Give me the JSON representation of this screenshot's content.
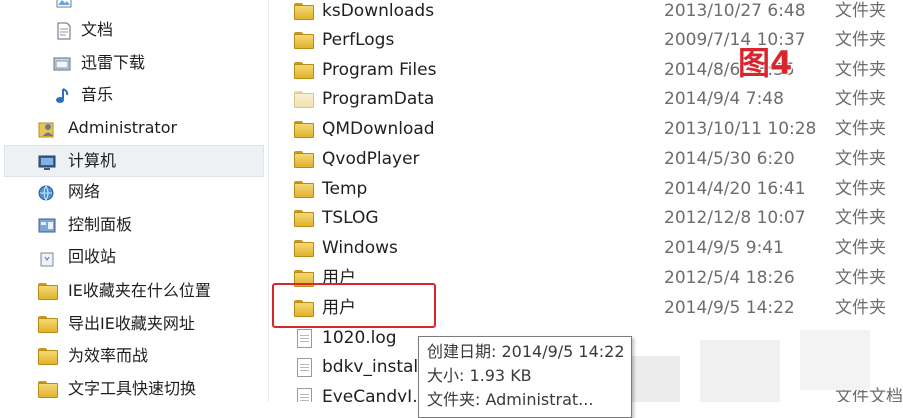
{
  "nav": {
    "items": [
      {
        "label": "文档",
        "icon": "document-icon"
      },
      {
        "label": "迅雷下载",
        "icon": "folder-library-icon"
      },
      {
        "label": "音乐",
        "icon": "music-note-icon"
      },
      {
        "label": "Administrator",
        "icon": "user-folder-icon"
      },
      {
        "label": "计算机",
        "icon": "computer-icon"
      },
      {
        "label": "网络",
        "icon": "network-icon"
      },
      {
        "label": "控制面板",
        "icon": "control-panel-icon"
      },
      {
        "label": "回收站",
        "icon": "recycle-bin-icon"
      },
      {
        "label": "IE收藏夹在什么位置",
        "icon": "folder-icon"
      },
      {
        "label": "导出IE收藏夹网址",
        "icon": "folder-icon"
      },
      {
        "label": "为效率而战",
        "icon": "folder-icon"
      },
      {
        "label": "文字工具快速切换",
        "icon": "folder-icon"
      }
    ]
  },
  "files": [
    {
      "name": "ksDownloads",
      "date": "2013/10/27 6:48",
      "type": "文件夹",
      "icon": "folder-icon"
    },
    {
      "name": "PerfLogs",
      "date": "2009/7/14 10:37",
      "type": "文件夹",
      "icon": "folder-icon"
    },
    {
      "name": "Program Files",
      "date": "2014/8/6 13:35",
      "type": "文件夹",
      "icon": "folder-icon"
    },
    {
      "name": "ProgramData",
      "date": "2014/9/4 7:48",
      "type": "文件夹",
      "icon": "folder-icon"
    },
    {
      "name": "QMDownload",
      "date": "2013/10/11 10:28",
      "type": "文件夹",
      "icon": "folder-icon"
    },
    {
      "name": "QvodPlayer",
      "date": "2014/5/30 6:20",
      "type": "文件夹",
      "icon": "folder-icon"
    },
    {
      "name": "Temp",
      "date": "2014/4/20 16:41",
      "type": "文件夹",
      "icon": "folder-icon"
    },
    {
      "name": "TSLOG",
      "date": "2012/12/8 10:07",
      "type": "文件夹",
      "icon": "folder-icon"
    },
    {
      "name": "Windows",
      "date": "2014/9/5 9:41",
      "type": "文件夹",
      "icon": "folder-icon"
    },
    {
      "name": "用户",
      "date": "2012/5/4 18:26",
      "type": "文件夹",
      "icon": "folder-icon"
    },
    {
      "name": "用户",
      "date": "2014/9/5 14:22",
      "type": "文件夹",
      "icon": "folder-icon"
    },
    {
      "name": "1020.log",
      "date": "",
      "type": "",
      "icon": "text-file-icon"
    },
    {
      "name": "bdkv_install",
      "date": "",
      "type": "",
      "icon": "text-file-icon"
    },
    {
      "name": "EyeCandyI...",
      "date": "",
      "type": "文件文档",
      "icon": "text-file-icon"
    }
  ],
  "figure_label": "图4",
  "tooltip": {
    "created": "创建日期: 2014/9/5 14:22",
    "size": "大小: 1.93 KB",
    "folder": "文件夹: Administrat..."
  },
  "colors": {
    "highlight": "#d8262d",
    "folder": "#e1b22e",
    "secondary_text": "#6d6d6d"
  }
}
